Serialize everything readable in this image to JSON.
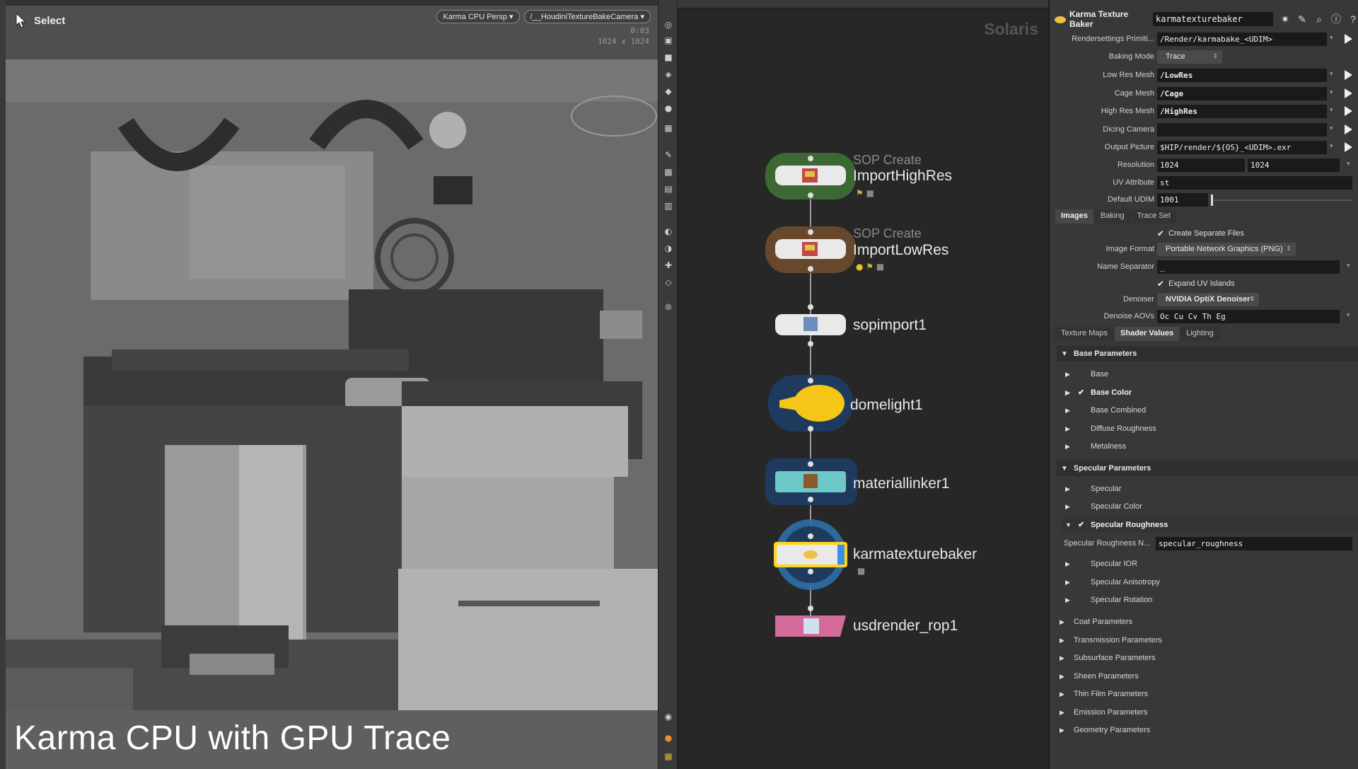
{
  "viewport": {
    "tool": "Select",
    "camera_menu": "Karma CPU Persp",
    "camera_path": "/__HoudiniTextureBakeCamera",
    "render_time": "0:03",
    "render_size": "1024 x 1024",
    "caption": "Karma CPU with GPU Trace"
  },
  "network": {
    "context": "Solaris",
    "nodes": [
      {
        "name": "ImportHighRes",
        "type": "SOP Create",
        "color": "#3d6b35"
      },
      {
        "name": "ImportLowRes",
        "type": "SOP Create",
        "color": "#6a4a2c"
      },
      {
        "name": "sopimport1",
        "type": "",
        "color": ""
      },
      {
        "name": "domelight1",
        "type": "",
        "color": "#1f3a5f"
      },
      {
        "name": "materiallinker1",
        "type": "",
        "color": "#6fc8c8"
      },
      {
        "name": "karmatexturebaker",
        "type": "",
        "color": "#ffd51a"
      },
      {
        "name": "usdrender_rop1",
        "type": "",
        "color": "#d46a9a"
      }
    ]
  },
  "params": {
    "node_type": "Karma Texture Baker",
    "node_name": "karmatexturebaker",
    "rendersettings_label": "Rendersettings Primiti...",
    "rendersettings_value": "/Render/karmabake_<UDIM>",
    "baking_mode_label": "Baking Mode",
    "baking_mode_value": "Trace",
    "low_res_label": "Low Res Mesh",
    "low_res_value": "/LowRes",
    "cage_label": "Cage Mesh",
    "cage_value": "/Cage",
    "high_res_label": "High Res Mesh",
    "high_res_value": "/HighRes",
    "dicing_label": "Dicing Camera",
    "dicing_value": "",
    "output_label": "Output Picture",
    "output_value": "$HIP/render/${OS}_<UDIM>.exr",
    "resolution_label": "Resolution",
    "resolution_x": "1024",
    "resolution_y": "1024",
    "uv_label": "UV Attribute",
    "uv_value": "st",
    "udim_label": "Default UDIM",
    "udim_value": "1001",
    "tabs1": [
      "Images",
      "Baking",
      "Trace Set"
    ],
    "create_separate": "Create Separate Files",
    "image_format_label": "Image Format",
    "image_format_value": "Portable Network Graphics (PNG)",
    "name_sep_label": "Name Separator",
    "name_sep_value": "_",
    "expand_uv": "Expand UV Islands",
    "denoiser_label": "Denoiser",
    "denoiser_value": "NVIDIA OptiX Denoiser",
    "denoise_aovs_label": "Denoise AOVs",
    "denoise_aovs_value": "Oc Cu Cv Th Eg",
    "tabs2": [
      "Texture Maps",
      "Shader Values",
      "Lighting"
    ],
    "base_section": "Base Parameters",
    "base_items": [
      "Base",
      "Base Color",
      "Base Combined",
      "Diffuse Roughness",
      "Metalness"
    ],
    "spec_section": "Specular Parameters",
    "spec_items": [
      "Specular",
      "Specular Color",
      "Specular Roughness"
    ],
    "spec_rough_name_label": "Specular Roughness N...",
    "spec_rough_name_value": "specular_roughness",
    "spec_items2": [
      "Specular IOR",
      "Specular Anisotropy",
      "Specular Rotation"
    ],
    "folds": [
      "Coat Parameters",
      "Transmission Parameters",
      "Subsurface Parameters",
      "Sheen Parameters",
      "Thin Film Parameters",
      "Emission Parameters",
      "Geometry Parameters"
    ]
  }
}
